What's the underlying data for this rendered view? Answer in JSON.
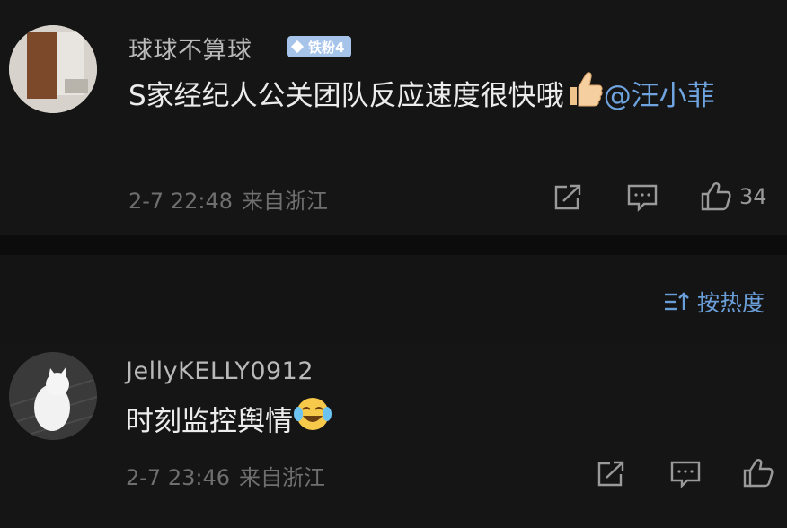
{
  "comments": [
    {
      "username": "球球不算球",
      "badge": "铁粉4",
      "text": "S家经纪人公关团队反应速度很快哦",
      "mention": "@汪小菲",
      "time": "2-7 22:48",
      "location": "来自浙江",
      "like_count": "34",
      "emoji": "thumbs-up"
    },
    {
      "username": "JellyKELLY0912",
      "text": "时刻监控舆情",
      "time": "2-7 23:46",
      "location": "来自浙江",
      "emoji": "laugh-cry"
    }
  ],
  "sort": {
    "label": "按热度",
    "icon": "sort-icon"
  },
  "colors": {
    "background": "#151515",
    "mention": "#6fa4e0",
    "badge": "#a6c4ea",
    "meta": "#6f6f6f"
  }
}
